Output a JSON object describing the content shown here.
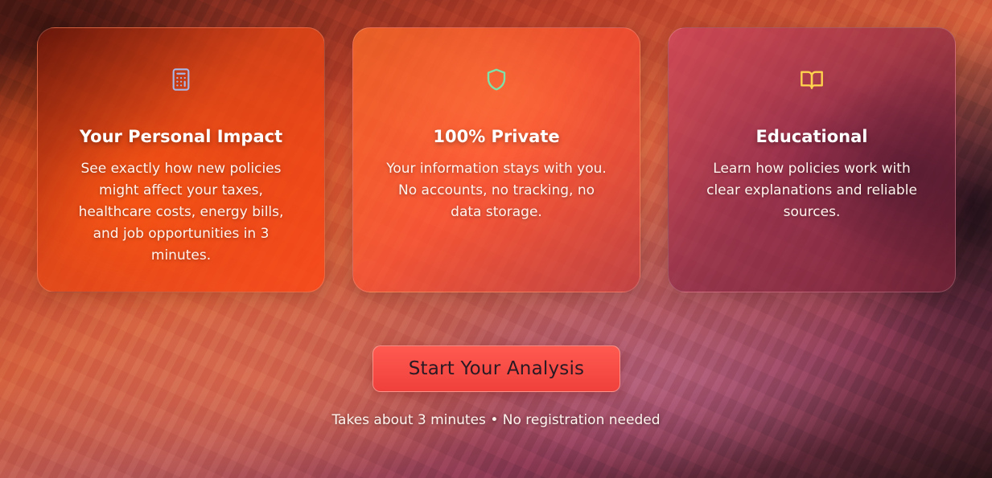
{
  "features": [
    {
      "icon": "calculator-icon",
      "icon_color": "#a8b8e8",
      "title": "Your Personal Impact",
      "description": "See exactly how new policies might affect your taxes, healthcare costs, energy bills, and job opportunities in 3 minutes."
    },
    {
      "icon": "shield-icon",
      "icon_color": "#7fe0a8",
      "title": "100% Private",
      "description": "Your information stays with you. No accounts, no tracking, no data storage."
    },
    {
      "icon": "book-open-icon",
      "icon_color": "#ffd34d",
      "title": "Educational",
      "description": "Learn how policies work with clear explanations and reliable sources."
    }
  ],
  "cta": {
    "label": "Start Your Analysis",
    "color": "#f0403c"
  },
  "footnote": "Takes about 3 minutes • No registration needed"
}
